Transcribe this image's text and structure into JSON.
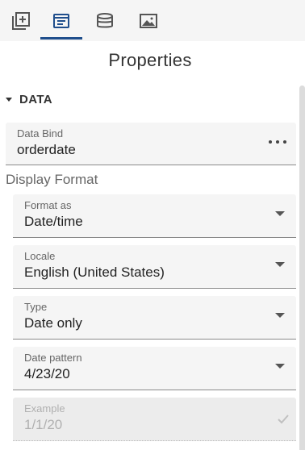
{
  "toolbar": {
    "tabs": [
      {
        "icon": "add-element-icon",
        "active": false
      },
      {
        "icon": "properties-icon",
        "active": true
      },
      {
        "icon": "database-icon",
        "active": false
      },
      {
        "icon": "image-icon",
        "active": false
      }
    ]
  },
  "panel": {
    "title": "Properties"
  },
  "section": {
    "label": "DATA",
    "collapse_icon": "caret-down-icon"
  },
  "data_bind": {
    "label": "Data Bind",
    "value": "orderdate",
    "more_icon": "more-horizontal-icon"
  },
  "display_format": {
    "label": "Display Format",
    "fields": [
      {
        "label": "Format as",
        "value": "Date/time"
      },
      {
        "label": "Locale",
        "value": "English (United States)"
      },
      {
        "label": "Type",
        "value": "Date only"
      },
      {
        "label": "Date pattern",
        "value": "4/23/20"
      }
    ],
    "example": {
      "label": "Example",
      "value": "1/1/20",
      "icon": "check-icon"
    }
  },
  "colors": {
    "accent": "#1f4e8c",
    "field_bg": "#f5f5f5",
    "toolbar_bg": "#f5f5f5"
  }
}
